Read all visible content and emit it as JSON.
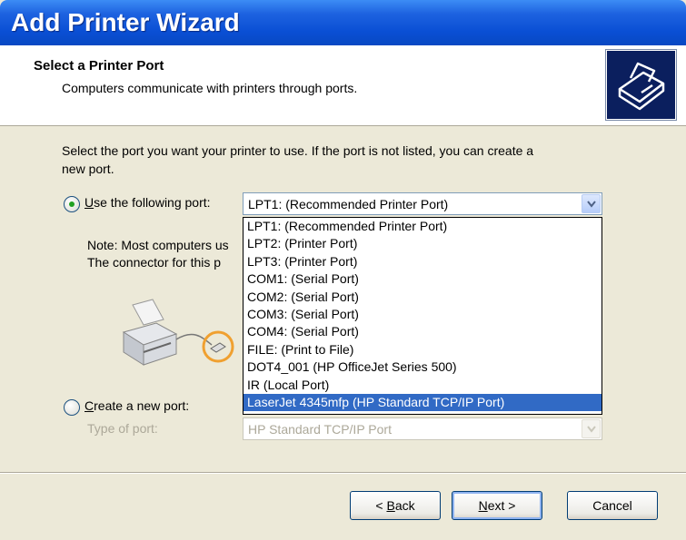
{
  "window": {
    "title": "Add Printer Wizard"
  },
  "header": {
    "title": "Select a Printer Port",
    "subtitle": "Computers communicate with printers through ports."
  },
  "instruction_line1": "Select the port you want your printer to use.  If the port is not listed, you can create a",
  "instruction_line2": "new port.",
  "use_port": {
    "label_underlined": "U",
    "label_rest": "se the following port:",
    "checked": true,
    "selected_value": "LPT1: (Recommended Printer Port)"
  },
  "note": {
    "line1": "Note: Most computers us",
    "line2": "The connector for this p"
  },
  "port_options": [
    "LPT1: (Recommended Printer Port)",
    "LPT2: (Printer Port)",
    "LPT3: (Printer Port)",
    "COM1: (Serial Port)",
    "COM2: (Serial Port)",
    "COM3: (Serial Port)",
    "COM4: (Serial Port)",
    "FILE: (Print to File)",
    "DOT4_001 (HP OfficeJet Series 500)",
    "IR (Local Port)",
    "LaserJet 4345mfp (HP Standard TCP/IP Port)"
  ],
  "highlighted_option": "LaserJet 4345mfp (HP Standard TCP/IP Port)",
  "create_port": {
    "label_underlined": "C",
    "label_rest": "reate a new port:",
    "checked": false,
    "type_label": "Type of port:",
    "type_value": "HP Standard TCP/IP Port"
  },
  "buttons": {
    "back_prefix": "< ",
    "back_underlined": "B",
    "back_rest": "ack",
    "next_underlined": "N",
    "next_rest": "ext >",
    "cancel": "Cancel"
  },
  "colors": {
    "title_blue": "#0a4fd4",
    "selection": "#316ac5",
    "radio_dot": "#21a121",
    "highlight_ring": "#f0a030"
  },
  "icons": [
    "printer-wizard-icon",
    "printer-illustration-icon",
    "port-connector-icon",
    "chevron-down-icon"
  ]
}
